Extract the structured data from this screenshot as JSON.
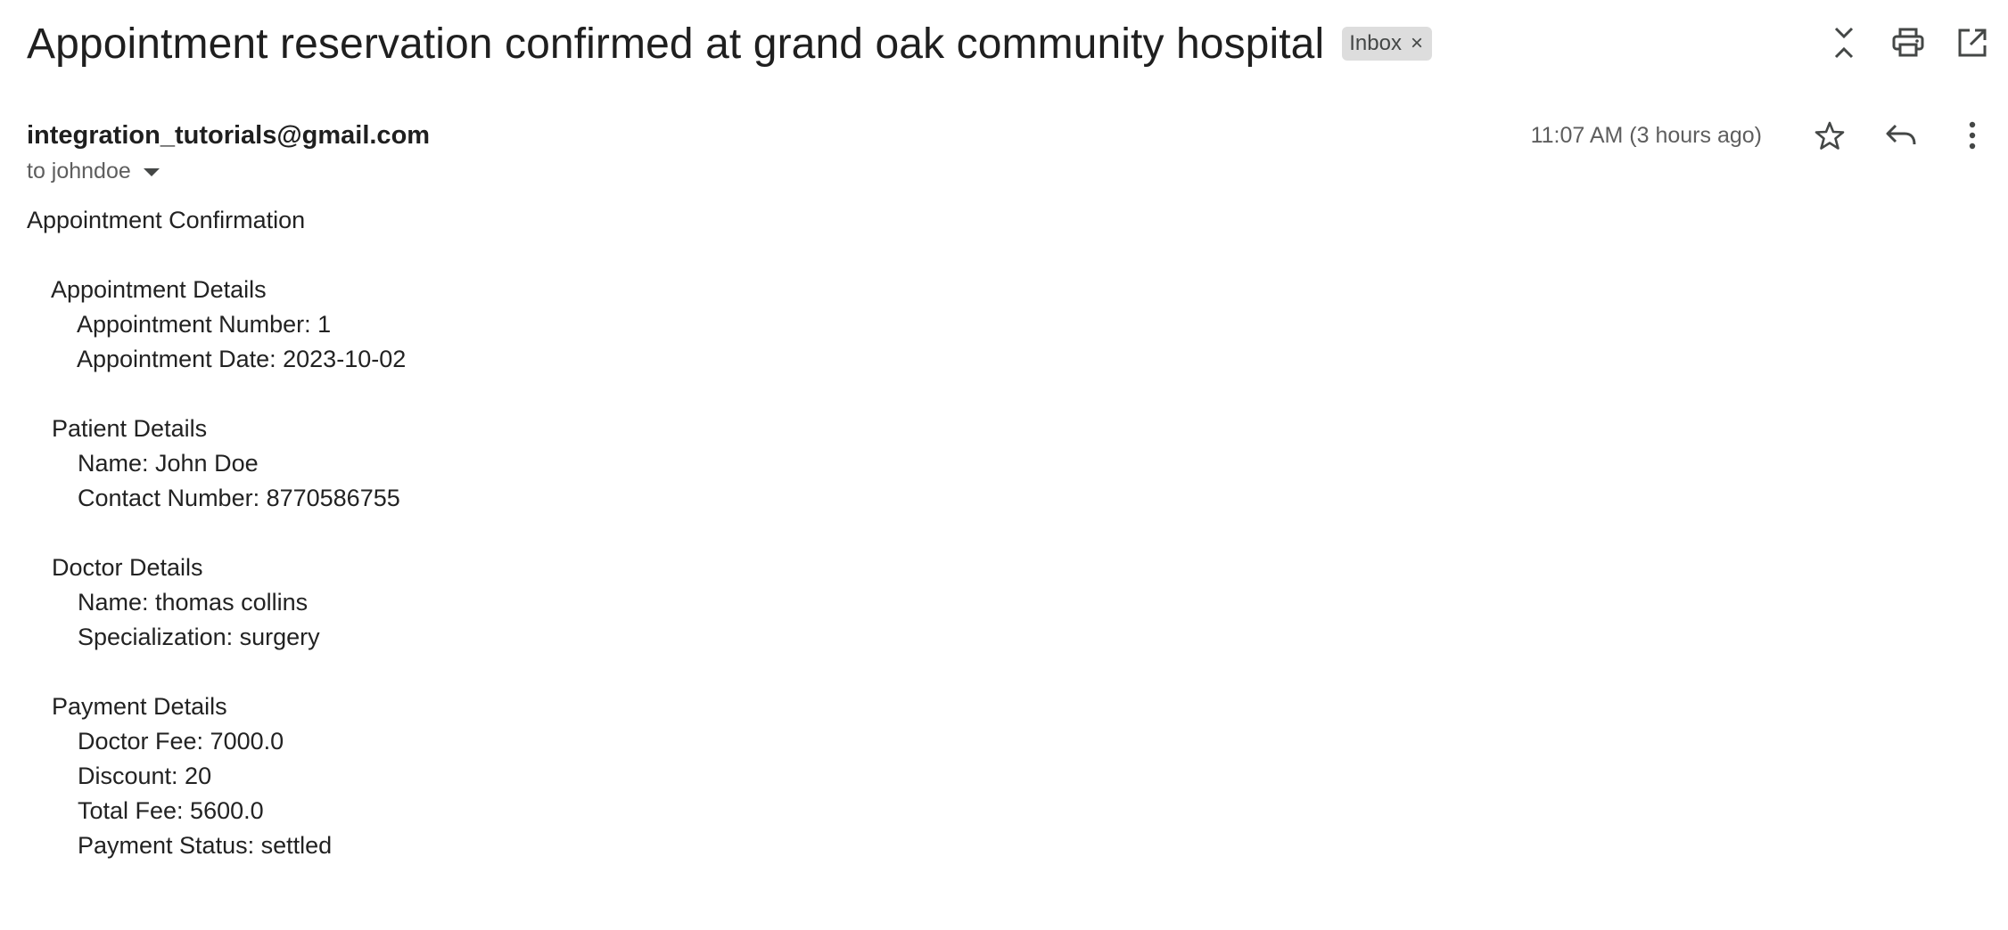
{
  "header": {
    "subject": "Appointment reservation confirmed at grand oak community hospital",
    "label": "Inbox",
    "label_close": "×"
  },
  "message": {
    "sender": "integration_tutorials@gmail.com",
    "recipient": "to johndoe",
    "timestamp": "11:07 AM (3 hours ago)"
  },
  "body": {
    "heading": "Appointment Confirmation",
    "sections": [
      {
        "title": "Appointment Details",
        "lines": [
          "Appointment Number: 1",
          "Appointment Date: 2023-10-02"
        ]
      },
      {
        "title": "Patient Details",
        "lines": [
          "Name: John Doe",
          "Contact Number: 8770586755"
        ]
      },
      {
        "title": "Doctor Details",
        "lines": [
          "Name: thomas collins",
          "Specialization: surgery"
        ]
      },
      {
        "title": "Payment Details",
        "lines": [
          "Doctor Fee: 7000.0",
          "Discount: 20",
          "Total Fee: 5600.0",
          "Payment Status: settled"
        ]
      }
    ]
  },
  "icons": {
    "expand": "expand-collapse-icon",
    "print": "print-icon",
    "open_new": "open-in-new-window-icon",
    "star": "star-icon",
    "reply": "reply-icon",
    "more": "more-vert-icon"
  },
  "colors": {
    "text": "#1f1f1f",
    "muted": "#5e5e5e",
    "chip_bg": "#dddddd",
    "icon": "#444746"
  }
}
